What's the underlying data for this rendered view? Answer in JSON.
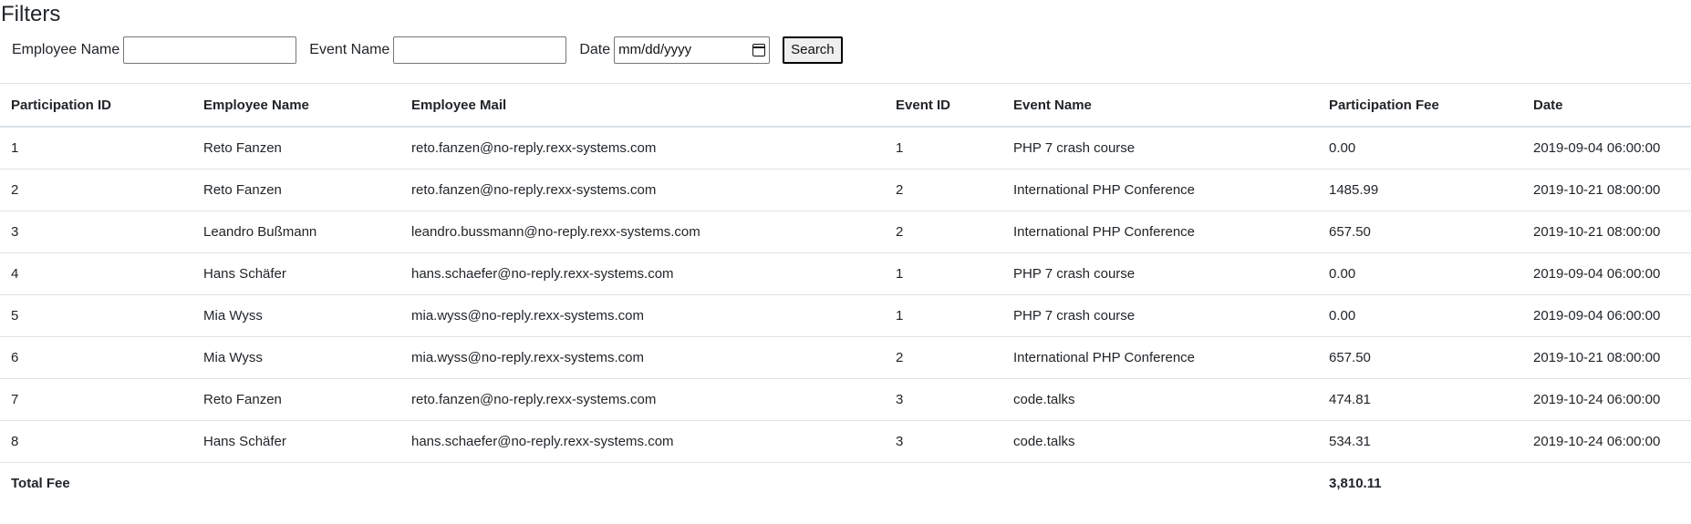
{
  "filters": {
    "title": "Filters",
    "employee_name_label": "Employee Name",
    "employee_name_value": "",
    "event_name_label": "Event Name",
    "event_name_value": "",
    "date_label": "Date",
    "date_placeholder": "mm/dd/yyyy",
    "search_label": "Search"
  },
  "table": {
    "headers": [
      "Participation ID",
      "Employee Name",
      "Employee Mail",
      "Event ID",
      "Event Name",
      "Participation Fee",
      "Date"
    ],
    "rows": [
      [
        "1",
        "Reto Fanzen",
        "reto.fanzen@no-reply.rexx-systems.com",
        "1",
        "PHP 7 crash course",
        "0.00",
        "2019-09-04 06:00:00"
      ],
      [
        "2",
        "Reto Fanzen",
        "reto.fanzen@no-reply.rexx-systems.com",
        "2",
        "International PHP Conference",
        "1485.99",
        "2019-10-21 08:00:00"
      ],
      [
        "3",
        "Leandro Bußmann",
        "leandro.bussmann@no-reply.rexx-systems.com",
        "2",
        "International PHP Conference",
        "657.50",
        "2019-10-21 08:00:00"
      ],
      [
        "4",
        "Hans Schäfer",
        "hans.schaefer@no-reply.rexx-systems.com",
        "1",
        "PHP 7 crash course",
        "0.00",
        "2019-09-04 06:00:00"
      ],
      [
        "5",
        "Mia Wyss",
        "mia.wyss@no-reply.rexx-systems.com",
        "1",
        "PHP 7 crash course",
        "0.00",
        "2019-09-04 06:00:00"
      ],
      [
        "6",
        "Mia Wyss",
        "mia.wyss@no-reply.rexx-systems.com",
        "2",
        "International PHP Conference",
        "657.50",
        "2019-10-21 08:00:00"
      ],
      [
        "7",
        "Reto Fanzen",
        "reto.fanzen@no-reply.rexx-systems.com",
        "3",
        "code.talks",
        "474.81",
        "2019-10-24 06:00:00"
      ],
      [
        "8",
        "Hans Schäfer",
        "hans.schaefer@no-reply.rexx-systems.com",
        "3",
        "code.talks",
        "534.31",
        "2019-10-24 06:00:00"
      ]
    ],
    "footer": {
      "label": "Total Fee",
      "total": "3,810.11"
    }
  },
  "icons": {
    "date_picker": "calendar-icon"
  },
  "colors": {
    "border": "#dee2e6",
    "text": "#212529"
  }
}
